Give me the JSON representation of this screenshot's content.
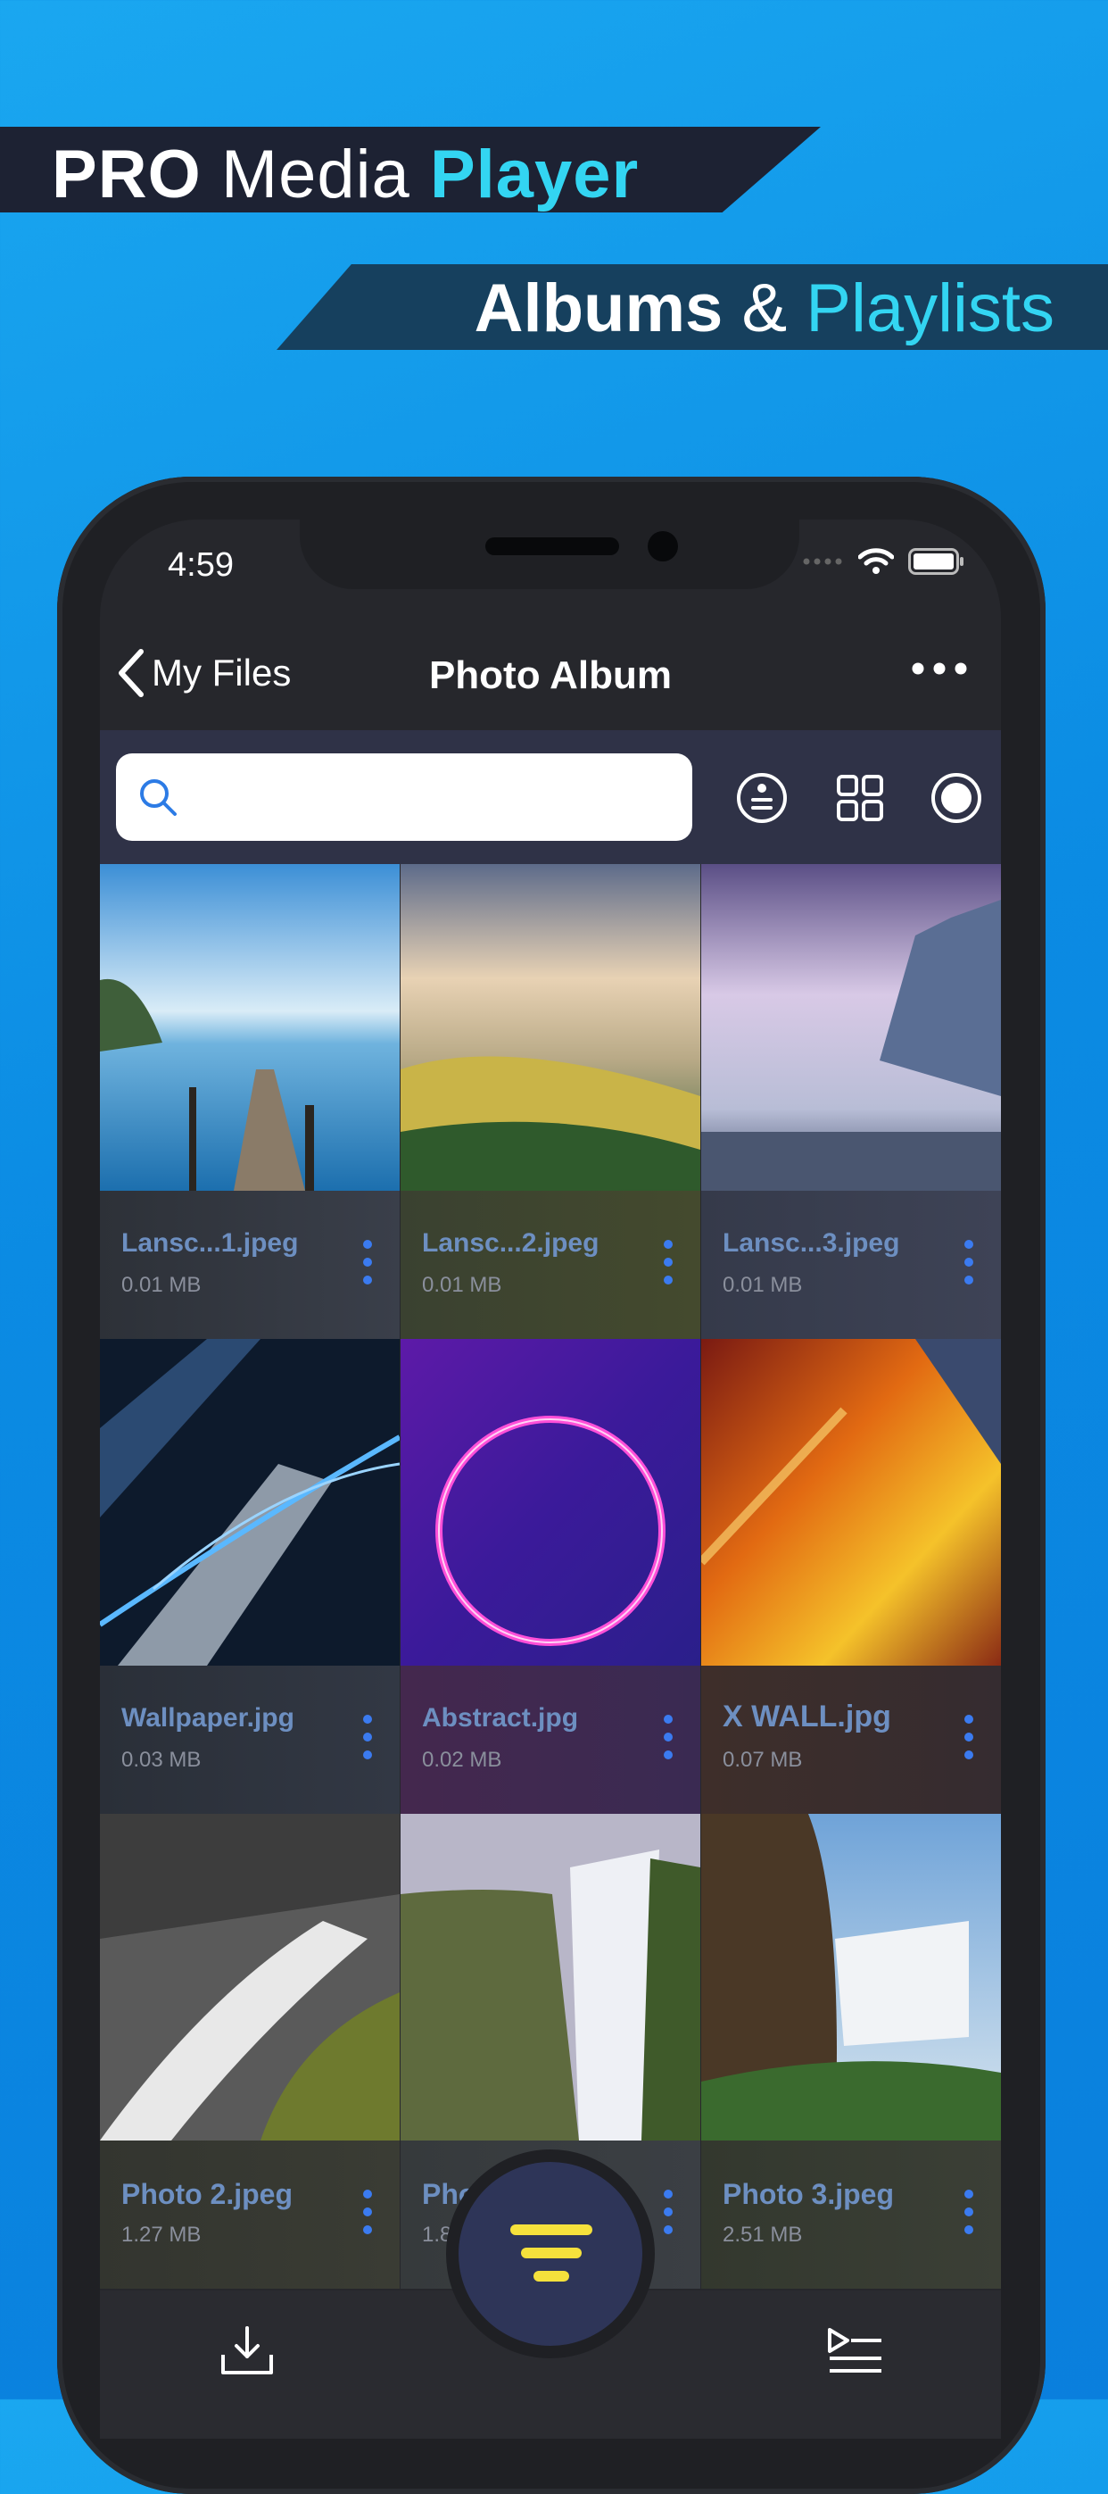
{
  "banner": {
    "line1_bold": "PRO",
    "line1_mid": "Media",
    "line1_accent": "Player",
    "line2_bold": "Albums",
    "line2_amp": "&",
    "line2_accent": "Playlists"
  },
  "status": {
    "time": "4:59"
  },
  "nav": {
    "back_label": "My Files",
    "title": "Photo Album"
  },
  "search": {
    "placeholder": ""
  },
  "files": [
    {
      "name": "Lansc...1.jpeg",
      "size": "0.01 MB"
    },
    {
      "name": "Lansc...2.jpeg",
      "size": "0.01 MB"
    },
    {
      "name": "Lansc...3.jpeg",
      "size": "0.01 MB"
    },
    {
      "name": "Wallpaper.jpg",
      "size": "0.03 MB"
    },
    {
      "name": "Abstract.jpg",
      "size": "0.02 MB"
    },
    {
      "name": "X WALL.jpg",
      "size": "0.07 MB"
    },
    {
      "name": "Photo 2.jpeg",
      "size": "1.27 MB"
    },
    {
      "name": "Pho",
      "size": "1.8"
    },
    {
      "name": "Photo 3.jpeg",
      "size": "2.51 MB"
    }
  ],
  "colors": {
    "accent": "#33d5f2",
    "filename": "#6d8fc1",
    "fab_icon": "#f5e13c",
    "dots": "#3b7bf0"
  },
  "icons": [
    "chevron-left-icon",
    "more-icon",
    "search-icon",
    "sort-icon",
    "grid-view-icon",
    "record-icon",
    "download-icon",
    "playlist-icon",
    "filter-icon",
    "wifi-icon",
    "battery-icon"
  ]
}
